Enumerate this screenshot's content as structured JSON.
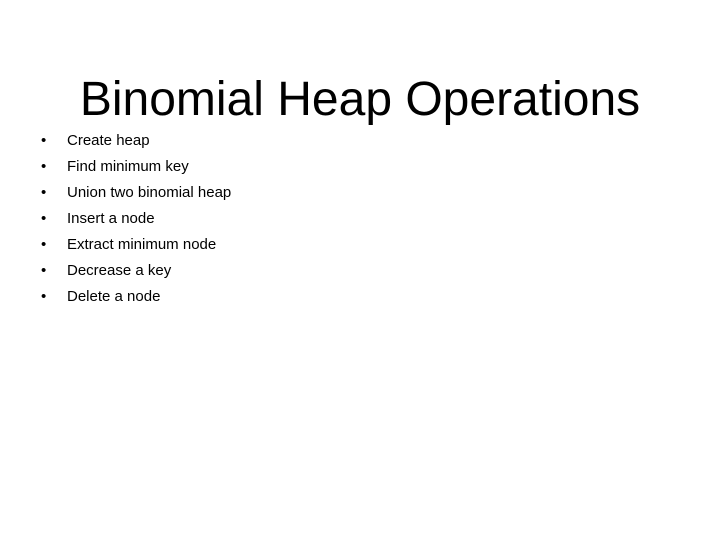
{
  "slide": {
    "title": "Binomial Heap Operations",
    "background_color": "#ffffff",
    "text_color": "#000000",
    "bullet_glyph": "•",
    "bullets": [
      {
        "label": "Create heap"
      },
      {
        "label": "Find minimum key"
      },
      {
        "label": "Union two binomial heap"
      },
      {
        "label": "Insert a node"
      },
      {
        "label": "Extract minimum node"
      },
      {
        "label": "Decrease a key"
      },
      {
        "label": "Delete a node"
      }
    ]
  }
}
